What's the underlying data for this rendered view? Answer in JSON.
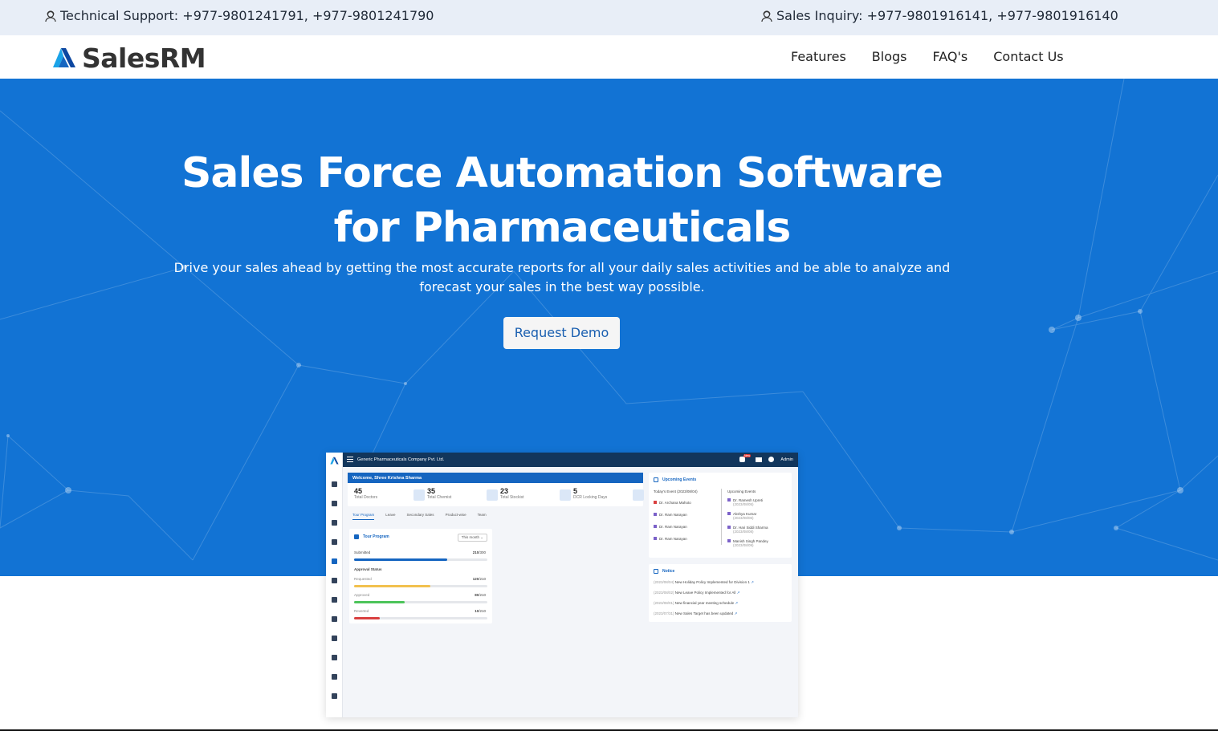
{
  "topbar": {
    "support": "Technical Support: +977-9801241791, +977-9801241790",
    "sales": "Sales Inquiry: +977-9801916141, +977-9801916140"
  },
  "nav": {
    "brand": "SalesRM",
    "items": [
      "Features",
      "Blogs",
      "FAQ's",
      "Contact Us"
    ]
  },
  "hero": {
    "title_line1": "Sales Force Automation Software",
    "title_line2": "for Pharmaceuticals",
    "subtitle_line1": "Drive your sales ahead by getting the most accurate reports for all your daily sales activities and be able to analyze and",
    "subtitle_line2": "forecast your sales in the best way possible.",
    "cta": "Request Demo"
  },
  "colors": {
    "hero_bg": "#1273d4",
    "brand_blue": "#1565c0"
  },
  "dashboard": {
    "company": "Generic Pharmaceuticals Company Pvt. Ltd.",
    "admin": "Admin",
    "badge": "New",
    "welcome": "Welcome, Shree Krishna Sharma",
    "stats": [
      {
        "value": "45",
        "label": "Total Doctors"
      },
      {
        "value": "35",
        "label": "Total Chemist"
      },
      {
        "value": "23",
        "label": "Total Stockist"
      },
      {
        "value": "5",
        "label": "DCR Locking Days"
      }
    ],
    "tabs": [
      "Tour Program",
      "Leave",
      "Secondary Sales",
      "Product-wise",
      "Team"
    ],
    "tour": {
      "title": "Tour Program",
      "filter": "This month",
      "submitted_label": "Submitted",
      "submitted": "210",
      "submitted_total": "/300",
      "approval_title": "Approval Status",
      "rows": [
        {
          "label": "Requested",
          "value": "120",
          "total": "/210",
          "fraction": 0.57,
          "color": "#f2c14e"
        },
        {
          "label": "Approved",
          "value": "80",
          "total": "/210",
          "fraction": 0.38,
          "color": "#4cc45a"
        },
        {
          "label": "Reverted",
          "value": "10",
          "total": "/210",
          "fraction": 0.19,
          "color": "#d94040"
        }
      ],
      "submitted_fraction": 0.7
    },
    "events": {
      "title": "Upcoming Events",
      "today_label": "Today's Event",
      "today_date": "(2023/08/04)",
      "today": [
        "Dr. Archana Mahoto",
        "Dr. Ram Narayan",
        "Dr. Ram Narayan",
        "Dr. Ram Narayan"
      ],
      "upcoming_label": "Upcoming Events",
      "upcoming": [
        {
          "name": "Dr. Ramesh Upreti",
          "date": "(2023/08/05)"
        },
        {
          "name": "Akshya Kumar",
          "date": "(2023/08/06)"
        },
        {
          "name": "Dr. Hari Siddi Sharma",
          "date": "(2023/08/08)"
        },
        {
          "name": "Manish Singh Pandey",
          "date": "(2023/08/09)"
        }
      ]
    },
    "notice": {
      "title": "Notice",
      "items": [
        {
          "date": "(2023/08/04)",
          "text": "New Holiday Policy Implemented for Division 1"
        },
        {
          "date": "(2023/08/02)",
          "text": "New Leave Policy Implemented for All"
        },
        {
          "date": "(2023/08/01)",
          "text": "New financial year meeting schedule"
        },
        {
          "date": "(2023/07/31)",
          "text": "New Sales Target has been updated"
        }
      ]
    }
  }
}
